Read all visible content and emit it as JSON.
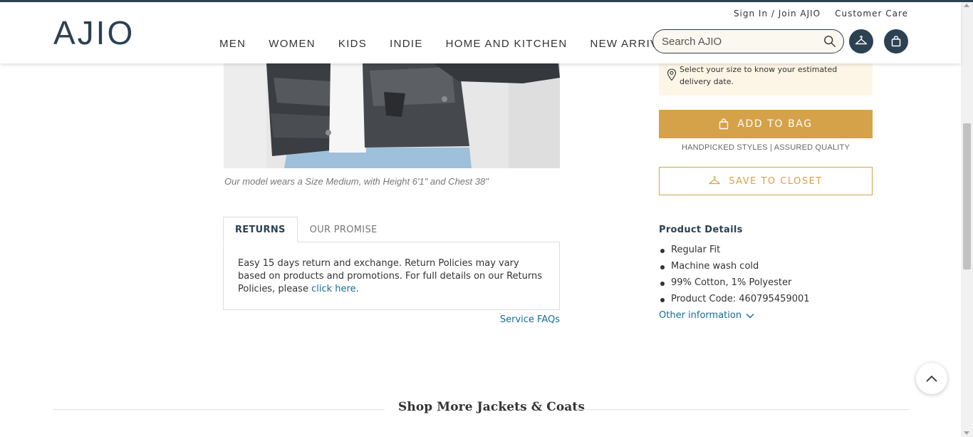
{
  "header": {
    "logo": "AJIO",
    "top_links": [
      "Sign In / Join AJIO",
      "Customer Care"
    ],
    "nav": [
      "MEN",
      "WOMEN",
      "KIDS",
      "INDIE",
      "HOME AND KITCHEN",
      "NEW ARRIVALS"
    ],
    "search_placeholder": "Search AJIO"
  },
  "product": {
    "model_caption": "Our model wears a Size Medium, with Height 6'1\" and Chest 38\""
  },
  "tabs": {
    "items": [
      "RETURNS",
      "OUR PROMISE"
    ],
    "active": "RETURNS",
    "returns_text": "Easy 15 days return and exchange. Return Policies may vary based on products and promotions. For full details on our Returns Policies, please ",
    "returns_link": "click here",
    "returns_end": ".",
    "service_faqs": "Service FAQs"
  },
  "purchase": {
    "delivery_note": "Select your size to know your estimated delivery date.",
    "add_to_bag": "ADD TO BAG",
    "quality_line": "HANDPICKED STYLES | ASSURED QUALITY",
    "save_to_closet": "SAVE TO CLOSET"
  },
  "details": {
    "title": "Product Details",
    "items": [
      "Regular Fit",
      "Machine wash cold",
      "99% Cotton, 1% Polyester",
      "Product Code: 460795459001"
    ],
    "other_info": "Other information"
  },
  "section": {
    "title": "Shop More Jackets & Coats"
  },
  "colors": {
    "brand_navy": "#2c4152",
    "gold": "#d5a249",
    "link_blue": "#176d93",
    "delivery_bg": "#fdf5e6"
  }
}
